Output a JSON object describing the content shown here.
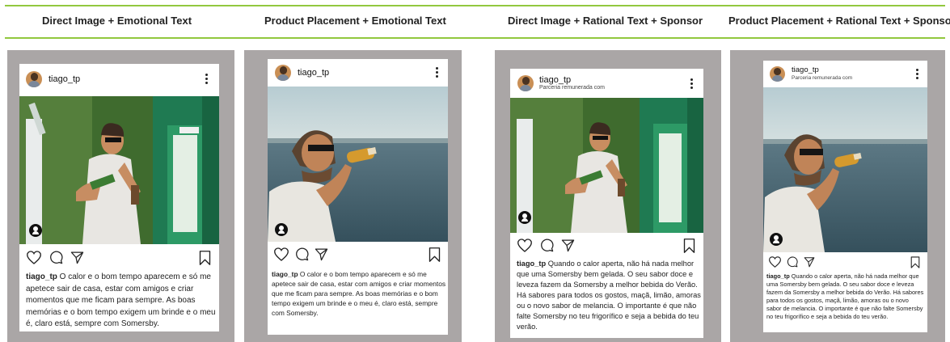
{
  "headers": [
    "Direct Image + Emotional Text",
    "Product Placement + Emotional Text",
    "Direct Image + Rational Text + Sponsor",
    "Product Placement + Rational Text + Sponsor"
  ],
  "posts": [
    {
      "username": "tiago_tp",
      "sponsor": "",
      "image": "direct-image-man-with-drink-green-wall",
      "caption_user": "tiago_tp",
      "caption": " O calor e o bom tempo aparecem e só me apetece sair de casa, estar com amigos e criar momentos que me ficam para sempre. As boas memórias e o bom tempo exigem um brinde e o meu é, claro está, sempre com Somersby."
    },
    {
      "username": "tiago_tp",
      "sponsor": "",
      "image": "product-placement-man-drinking-by-sea",
      "caption_user": "tiago_tp",
      "caption": " O calor e o bom tempo aparecem e só me apetece sair de casa, estar com amigos e criar momentos que me ficam para sempre. As boas memórias e o bom tempo exigem um brinde e o meu é, claro está, sempre com Somersby."
    },
    {
      "username": "tiago_tp",
      "sponsor": "Parceria remunerada com",
      "image": "direct-image-man-with-drink-green-wall",
      "caption_user": "tiago_tp",
      "caption": " Quando o calor aperta, não há nada melhor que uma Somersby bem gelada. O seu sabor doce e leveza fazem da Somersby a melhor bebida do Verão. Há sabores para todos os gostos, maçã, limão, amoras ou o novo sabor de melancia. O importante é que não falte Somersby no teu frigorífico e seja a bebida do teu verão."
    },
    {
      "username": "tiago_tp",
      "sponsor": "Parceria remunerada com",
      "image": "product-placement-man-drinking-by-sea",
      "caption_user": "tiago_tp",
      "caption": " Quando o calor aperta, não há nada melhor que uma Somersby bem gelada. O seu sabor doce e leveza fazem da Somersby a melhor bebida do Verão. Há sabores para todos os gostos, maçã, limão, amoras ou o novo sabor de melancia. O importante é que não falte Somersby no teu frigorífico e seja a bebida do teu verão."
    }
  ]
}
